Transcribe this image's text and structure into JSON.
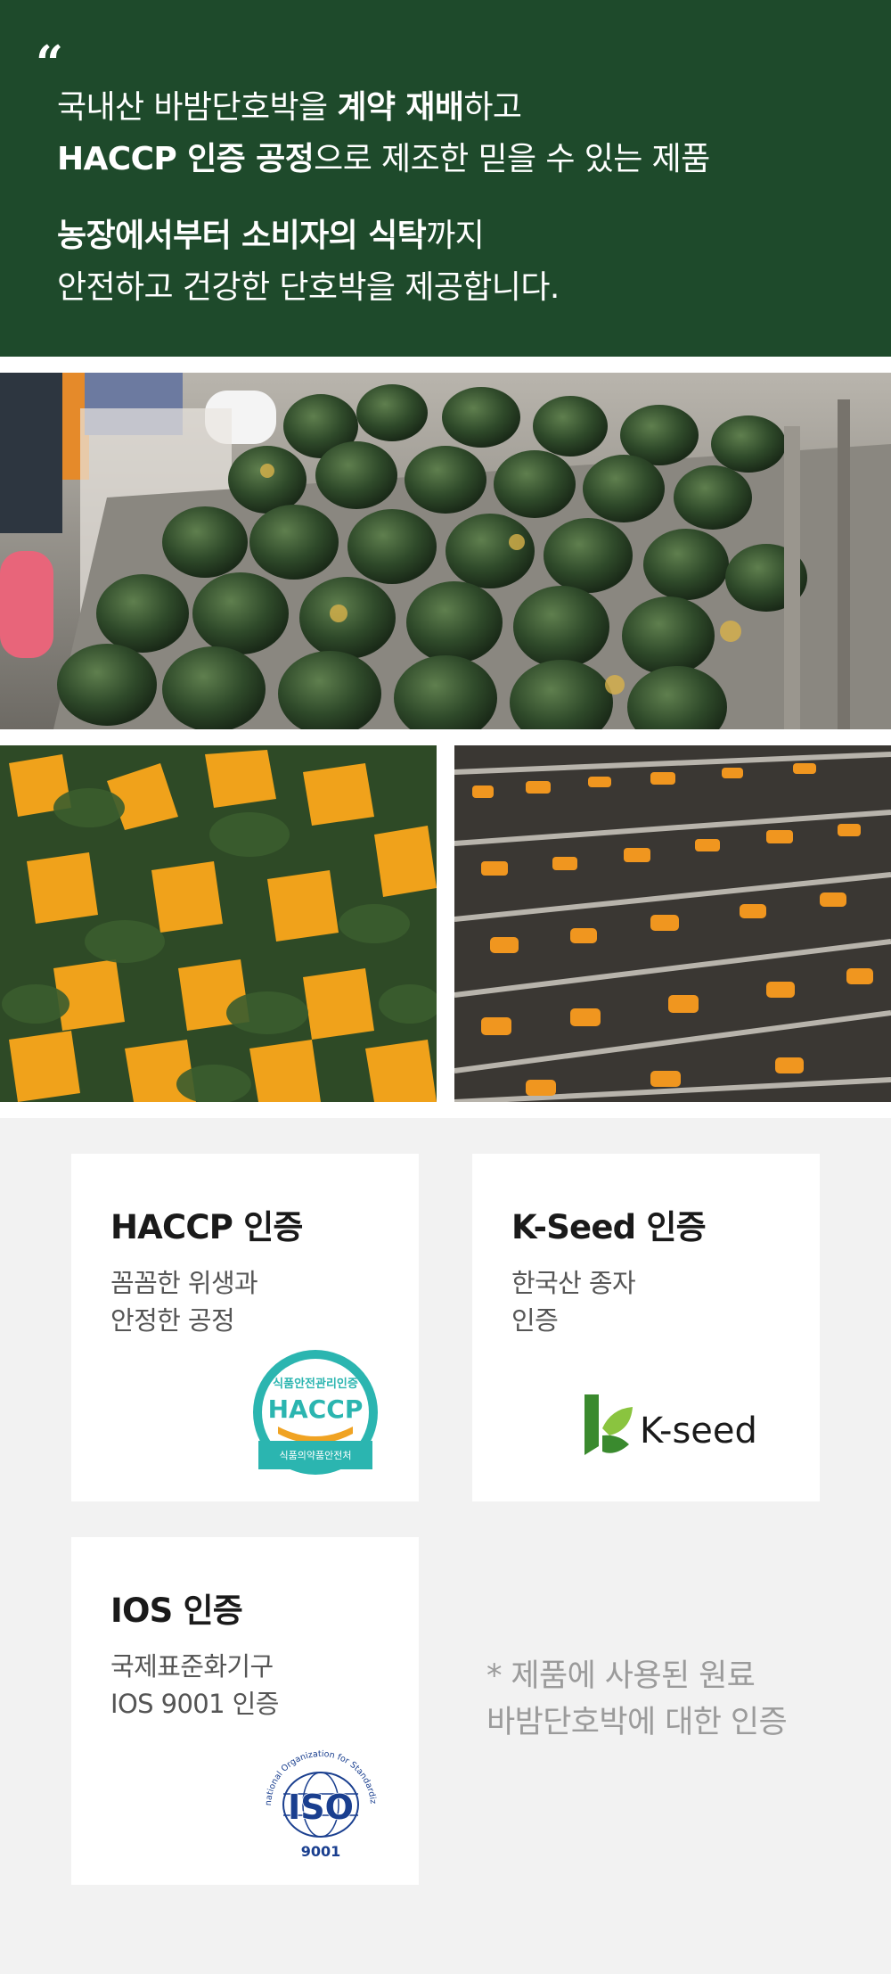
{
  "hero": {
    "quote_mark": "“",
    "line1_a": "국내산 바밤단호박을 ",
    "line1_b": "계약 재배",
    "line1_c": "하고",
    "line2_a": "HACCP 인증 공정",
    "line2_b": "으로 제조한 믿을 수 있는 제품",
    "line3_a": "농장에서부터 소비자의 식탁",
    "line3_b": "까지",
    "line4": "안전하고 건강한 단호박을 제공합니다."
  },
  "certs": [
    {
      "title": "HACCP 인증",
      "desc1": "꼼꼼한 위생과",
      "desc2": "안정한 공정",
      "logo_icon": "haccp-logo"
    },
    {
      "title": "K-Seed 인증",
      "desc1": "한국산 종자",
      "desc2": "인증",
      "logo_icon": "kseed-logo"
    },
    {
      "title": "IOS 인증",
      "desc1": "국제표준화기구",
      "desc2": "IOS 9001 인증",
      "logo_icon": "iso-logo"
    }
  ],
  "logos": {
    "haccp_top": "식품안전관리인증",
    "haccp_main": "HACCP",
    "haccp_bottom": "식품의약품안전처",
    "kseed_text": "K-seed",
    "iso_arc": "International Organization for Standardization",
    "iso_main": "ISO",
    "iso_num": "9001"
  },
  "note": {
    "line1": "* 제품에 사용된 원료",
    "line2": "바밤단호박에 대한 인증"
  },
  "colors": {
    "hero_bg": "#1e4a2b",
    "cert_bg": "#f2f2f2",
    "haccp_teal": "#2bb5b0",
    "haccp_orange": "#f0a323",
    "kseed_green": "#3a8a2e",
    "iso_blue": "#1a3f8f"
  }
}
